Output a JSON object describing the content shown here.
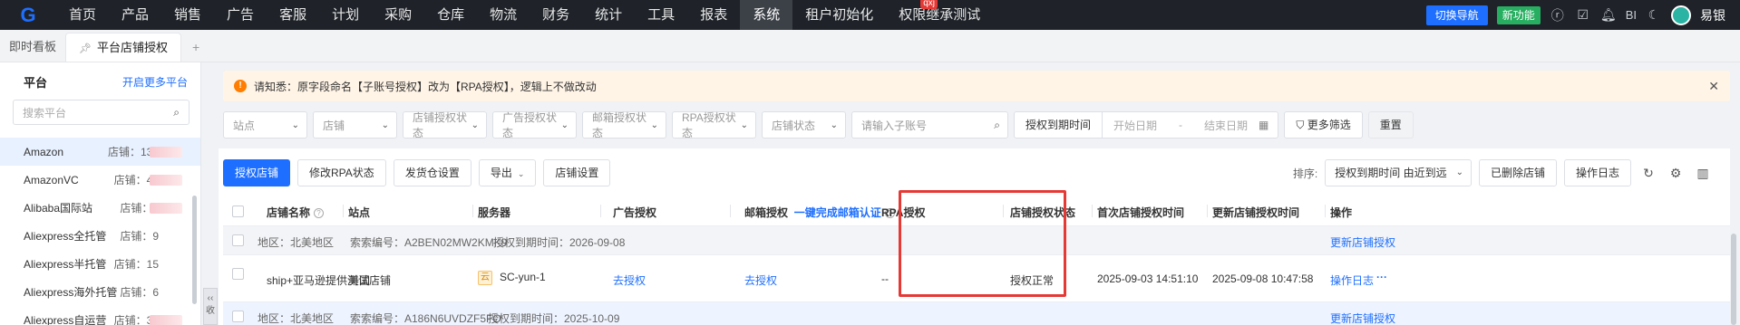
{
  "topnav": {
    "logo": "G",
    "items": [
      "首页",
      "产品",
      "销售",
      "广告",
      "客服",
      "计划",
      "采购",
      "仓库",
      "物流",
      "财务",
      "统计",
      "工具",
      "报表",
      "系统",
      "租户初始化",
      "权限继承测试"
    ],
    "active_index": 13,
    "badge": "qxj",
    "switch_label": "切换导航",
    "new_label": "新功能",
    "bi_label": "BI",
    "user": "易银"
  },
  "tabs": {
    "items": [
      "即时看板",
      "平台店铺授权"
    ],
    "active_index": 1,
    "add": "+"
  },
  "sidebar": {
    "title": "平台",
    "more_link": "开启更多平台",
    "search_placeholder": "搜索平台",
    "items": [
      {
        "name": "Amazon",
        "count": "店铺：137"
      },
      {
        "name": "AmazonVC",
        "count": "店铺：42"
      },
      {
        "name": "Alibaba国际站",
        "count": "店铺：9"
      },
      {
        "name": "Aliexpress全托管",
        "count": "店铺：9"
      },
      {
        "name": "Aliexpress半托管",
        "count": "店铺：15"
      },
      {
        "name": "Aliexpress海外托管",
        "count": "店铺：6"
      },
      {
        "name": "Aliexpress自运营",
        "count": "店铺：38"
      }
    ],
    "collapse_label": "收"
  },
  "notice": {
    "text": "请知悉：原字段命名【子账号授权】改为【RPA授权】，逻辑上不做改动"
  },
  "filters": {
    "selects": [
      "站点",
      "店铺",
      "店铺授权状态",
      "广告授权状态",
      "邮箱授权状态",
      "RPA授权状态",
      "店铺状态"
    ],
    "sub_account_placeholder": "请输入子账号",
    "date_label": "授权到期时间",
    "start_placeholder": "开始日期",
    "end_placeholder": "结束日期",
    "date_sep": "-",
    "more_filter": "更多筛选",
    "reset": "重置"
  },
  "actions": {
    "authorize": "授权店铺",
    "modify_rpa": "修改RPA状态",
    "ship_settings": "发货仓设置",
    "export": "导出",
    "store_settings": "店铺设置"
  },
  "sort": {
    "label": "排序:",
    "value": "授权到期时间 由近到远",
    "deleted": "已删除店铺",
    "log": "操作日志"
  },
  "table": {
    "headers": {
      "store": "店铺名称",
      "site": "站点",
      "server": "服务器",
      "ad": "广告授权",
      "email": "邮箱授权",
      "email_link": "一键完成邮箱认证",
      "rpa": "RPA授权",
      "status": "店铺授权状态",
      "first_time": "首次店铺授权时间",
      "update_time": "更新店铺授权时间",
      "ops": "操作"
    },
    "groups": [
      {
        "region": "地区：北美地区",
        "code": "索索编号：A2BEN02MW2KMK9",
        "expire": "授权到期时间：2026-09-08",
        "renew": "更新店铺授权",
        "row": {
          "store": "ship+亚马逊提供测试店铺",
          "site": "美国",
          "server_icon": "云",
          "server": "SC-yun-1",
          "ad": "去授权",
          "email": "去授权",
          "rpa": "--",
          "status": "授权正常",
          "first_time": "2025-09-03 14:51:10",
          "update_time": "2025-09-08 10:47:58",
          "log": "操作日志",
          "more": "···"
        }
      },
      {
        "region": "地区：北美地区",
        "code": "索索编号：A186N6UVDZF5FO",
        "expire": "授权到期时间：2025-10-09",
        "renew": "更新店铺授权"
      }
    ]
  }
}
